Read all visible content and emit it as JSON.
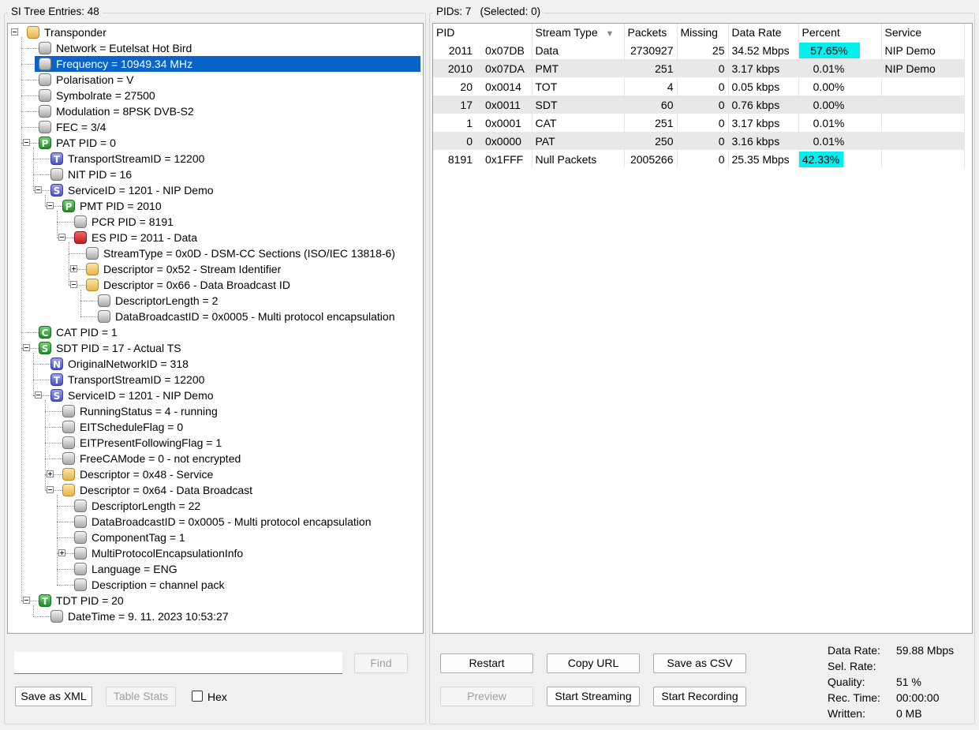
{
  "left": {
    "title": "SI Tree Entries: 48",
    "tree": [
      {
        "label": "Transponder",
        "icon": "folder",
        "exp": "minus",
        "depth": 0
      },
      {
        "label": "Network = Eutelsat Hot Bird",
        "icon": "gray",
        "depth": 1
      },
      {
        "label": "Frequency = 10949.34 MHz",
        "icon": "gray",
        "depth": 1,
        "selected": true
      },
      {
        "label": "Polarisation = V",
        "icon": "gray",
        "depth": 1
      },
      {
        "label": "Symbolrate = 27500",
        "icon": "gray",
        "depth": 1
      },
      {
        "label": "Modulation = 8PSK DVB-S2",
        "icon": "gray",
        "depth": 1
      },
      {
        "label": "FEC = 3/4",
        "icon": "gray",
        "depth": 1
      },
      {
        "label": "PAT PID = 0",
        "icon": "green",
        "letter": "P",
        "exp": "minus",
        "depth": 1
      },
      {
        "label": "TransportStreamID = 12200",
        "icon": "blue",
        "letter": "T",
        "depth": 2
      },
      {
        "label": "NIT PID = 16",
        "icon": "gray",
        "depth": 2
      },
      {
        "label": "ServiceID = 1201 - NIP Demo",
        "icon": "blue",
        "letter": "S",
        "exp": "minus",
        "depth": 2
      },
      {
        "label": "PMT PID = 2010",
        "icon": "green",
        "letter": "P",
        "exp": "minus",
        "depth": 3
      },
      {
        "label": "PCR PID = 8191",
        "icon": "gray",
        "depth": 4
      },
      {
        "label": "ES PID = 2011 - Data",
        "icon": "red",
        "exp": "minus",
        "depth": 4
      },
      {
        "label": "StreamType = 0x0D - DSM-CC Sections (ISO/IEC 13818-6)",
        "icon": "gray",
        "depth": 5
      },
      {
        "label": "Descriptor = 0x52 - Stream Identifier",
        "icon": "folder",
        "exp": "plus",
        "depth": 5
      },
      {
        "label": "Descriptor = 0x66 - Data Broadcast ID",
        "icon": "folder",
        "exp": "minus",
        "depth": 5
      },
      {
        "label": "DescriptorLength = 2",
        "icon": "gray",
        "depth": 6
      },
      {
        "label": "DataBroadcastID = 0x0005 - Multi protocol encapsulation",
        "icon": "gray",
        "depth": 6
      },
      {
        "label": "CAT PID = 1",
        "icon": "green",
        "letter": "C",
        "depth": 1
      },
      {
        "label": "SDT PID = 17 - Actual TS",
        "icon": "green",
        "letter": "S",
        "exp": "minus",
        "depth": 1
      },
      {
        "label": "OriginalNetworkID = 318",
        "icon": "blue",
        "letter": "N",
        "depth": 2
      },
      {
        "label": "TransportStreamID = 12200",
        "icon": "blue",
        "letter": "T",
        "depth": 2
      },
      {
        "label": "ServiceID = 1201 - NIP Demo",
        "icon": "blue",
        "letter": "S",
        "exp": "minus",
        "depth": 2
      },
      {
        "label": "RunningStatus = 4 - running",
        "icon": "gray",
        "depth": 3
      },
      {
        "label": "EITScheduleFlag = 0",
        "icon": "gray",
        "depth": 3
      },
      {
        "label": "EITPresentFollowingFlag = 1",
        "icon": "gray",
        "depth": 3
      },
      {
        "label": "FreeCAMode = 0 - not encrypted",
        "icon": "gray",
        "depth": 3
      },
      {
        "label": "Descriptor = 0x48 - Service",
        "icon": "folder",
        "exp": "plus",
        "depth": 3
      },
      {
        "label": "Descriptor = 0x64 - Data Broadcast",
        "icon": "folder",
        "exp": "minus",
        "depth": 3
      },
      {
        "label": "DescriptorLength = 22",
        "icon": "gray",
        "depth": 4
      },
      {
        "label": "DataBroadcastID = 0x0005 - Multi protocol encapsulation",
        "icon": "gray",
        "depth": 4
      },
      {
        "label": "ComponentTag = 1",
        "icon": "gray",
        "depth": 4
      },
      {
        "label": "MultiProtocolEncapsulationInfo",
        "icon": "gray",
        "exp": "plus",
        "depth": 4
      },
      {
        "label": "Language = ENG",
        "icon": "gray",
        "depth": 4
      },
      {
        "label": "Description = channel pack",
        "icon": "gray",
        "depth": 4
      },
      {
        "label": "TDT PID = 20",
        "icon": "green",
        "letter": "T",
        "exp": "minus",
        "depth": 1
      },
      {
        "label": "DateTime = 9. 11. 2023 10:53:27",
        "icon": "gray",
        "depth": 2
      }
    ],
    "search": {
      "value": "",
      "placeholder": ""
    },
    "find_label": "Find",
    "save_xml_label": "Save as XML",
    "table_stats_label": "Table Stats",
    "hex_label": "Hex"
  },
  "right": {
    "title": "PIDs: 7",
    "selected": "(Selected: 0)",
    "columns": {
      "pid": "PID",
      "stream_type": "Stream Type",
      "packets": "Packets",
      "missing": "Missing",
      "data_rate": "Data Rate",
      "percent": "Percent",
      "service": "Service"
    },
    "rows": [
      {
        "pid": "2011",
        "hex": "0x07DB",
        "type": "Data",
        "packets": "2730927",
        "missing": "25",
        "rate": "34.52 Mbps",
        "percent": "57.65%",
        "pct": 57.65,
        "service": "NIP Demo"
      },
      {
        "pid": "2010",
        "hex": "0x07DA",
        "type": "PMT",
        "packets": "251",
        "missing": "0",
        "rate": "3.17 kbps",
        "percent": "0.01%",
        "pct": 0.01,
        "service": "NIP Demo"
      },
      {
        "pid": "20",
        "hex": "0x0014",
        "type": "TOT",
        "packets": "4",
        "missing": "0",
        "rate": "0.05 kbps",
        "percent": "0.00%",
        "pct": 0,
        "service": ""
      },
      {
        "pid": "17",
        "hex": "0x0011",
        "type": "SDT",
        "packets": "60",
        "missing": "0",
        "rate": "0.76 kbps",
        "percent": "0.00%",
        "pct": 0,
        "service": ""
      },
      {
        "pid": "1",
        "hex": "0x0001",
        "type": "CAT",
        "packets": "251",
        "missing": "0",
        "rate": "3.17 kbps",
        "percent": "0.01%",
        "pct": 0.01,
        "service": ""
      },
      {
        "pid": "0",
        "hex": "0x0000",
        "type": "PAT",
        "packets": "250",
        "missing": "0",
        "rate": "3.16 kbps",
        "percent": "0.01%",
        "pct": 0.01,
        "service": ""
      },
      {
        "pid": "8191",
        "hex": "0x1FFF",
        "type": "Null Packets",
        "packets": "2005266",
        "missing": "0",
        "rate": "25.35 Mbps",
        "percent": "42.33%",
        "pct": 42.33,
        "service": ""
      }
    ],
    "buttons": {
      "restart": "Restart",
      "copy_url": "Copy URL",
      "save_csv": "Save as CSV",
      "preview": "Preview",
      "start_streaming": "Start Streaming",
      "start_recording": "Start Recording"
    },
    "stats": [
      {
        "label": "Data Rate:",
        "value": "59.88 Mbps"
      },
      {
        "label": "Sel. Rate:",
        "value": ""
      },
      {
        "label": "Quality:",
        "value": "51 %"
      },
      {
        "label": "Rec. Time:",
        "value": "00:00:00"
      },
      {
        "label": "Written:",
        "value": "0 MB"
      }
    ],
    "highlight_color": "#00f0f0"
  }
}
